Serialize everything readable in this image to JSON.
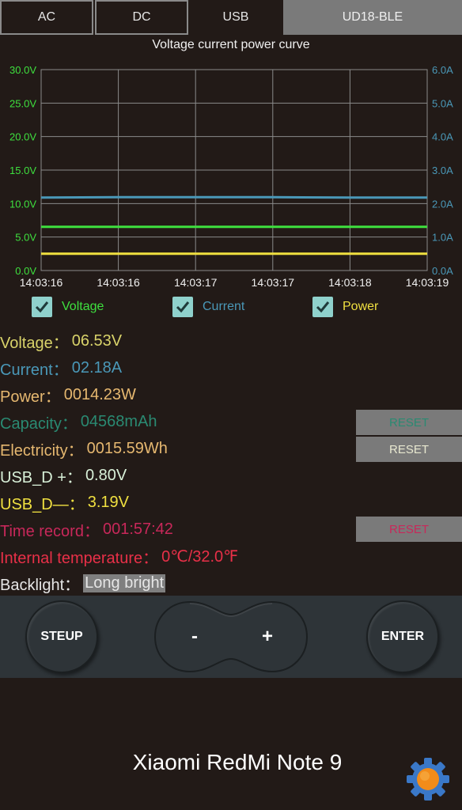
{
  "tabs": [
    {
      "label": "AC"
    },
    {
      "label": "DC"
    },
    {
      "label": "USB"
    },
    {
      "label": "UD18-BLE"
    }
  ],
  "colors": {
    "voltage": "#3ee03e",
    "current": "#4a98b8",
    "power": "#f0e040",
    "background": "#221a17",
    "button_gray": "#7a7a7a"
  },
  "chart_data": {
    "type": "line",
    "title": "Voltage current power curve",
    "x": [
      "14:03:16",
      "14:03:16",
      "14:03:17",
      "14:03:17",
      "14:03:18",
      "14:03:19"
    ],
    "y_left": {
      "ticks": [
        "0.0V",
        "5.0V",
        "10.0V",
        "15.0V",
        "20.0V",
        "25.0V",
        "30.0V"
      ],
      "ylim": [
        0,
        30
      ],
      "unit": "V"
    },
    "y_right": {
      "ticks": [
        "0.0A",
        "1.0A",
        "2.0A",
        "3.0A",
        "4.0A",
        "5.0A",
        "6.0A"
      ],
      "ylim": [
        0,
        6
      ],
      "unit": "A"
    },
    "grid": true,
    "series": [
      {
        "name": "Voltage",
        "axis": "left",
        "values": [
          6.53,
          6.53,
          6.53,
          6.53,
          6.53,
          6.53
        ]
      },
      {
        "name": "Current",
        "axis": "right",
        "values": [
          2.18,
          2.19,
          2.19,
          2.19,
          2.18,
          2.18
        ]
      },
      {
        "name": "Power",
        "axis": "left",
        "values": [
          2.5,
          2.5,
          2.5,
          2.5,
          2.5,
          2.5
        ]
      }
    ]
  },
  "legend": [
    {
      "label": "Voltage",
      "checked": true
    },
    {
      "label": "Current",
      "checked": true
    },
    {
      "label": "Power",
      "checked": true
    }
  ],
  "readings": {
    "voltage": {
      "label": "Voltage：",
      "value": "06.53V",
      "color": "#d9d36a"
    },
    "current": {
      "label": "Current：",
      "value": "02.18A",
      "color": "#4a98b8"
    },
    "power": {
      "label": "Power：",
      "value": "0014.23W",
      "color": "#e6b870"
    },
    "capacity": {
      "label": "Capacity：",
      "value": "04568mAh",
      "color": "#2a8a72"
    },
    "electricity": {
      "label": "Electricity：",
      "value": "0015.59Wh",
      "color": "#e6b870"
    },
    "usb_dp": {
      "label": "USB_D +：",
      "value": "0.80V",
      "color": "#d8f0d8"
    },
    "usb_dm": {
      "label": "USB_D—：",
      "value": "3.19V",
      "color": "#f0e040"
    },
    "time_record": {
      "label": "Time record：",
      "value": "001:57:42",
      "color": "#c8285a"
    },
    "temperature": {
      "label": "Internal temperature：",
      "value": "0℃/32.0℉",
      "color": "#e83048"
    },
    "backlight": {
      "label": "Backlight：",
      "value": "Long bright",
      "color": "#e6e6e6"
    }
  },
  "reset_buttons": {
    "capacity": {
      "label": "RESET",
      "color": "#2a8a72"
    },
    "electricity": {
      "label": "RESET",
      "color": "#e8e8d0"
    },
    "time": {
      "label": "RESET",
      "color": "#c8285a"
    }
  },
  "controls": {
    "setup_label": "STEUP",
    "minus_label": "-",
    "plus_label": "+",
    "enter_label": "ENTER"
  },
  "device_name": "Xiaomi RedMi Note 9",
  "settings_icon": "gear-icon"
}
